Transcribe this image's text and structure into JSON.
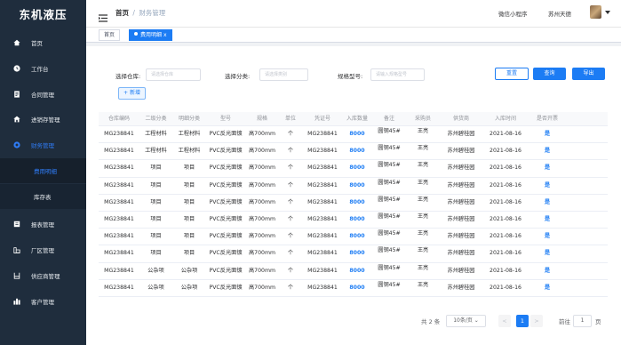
{
  "sidebar": {
    "brand": "东机液压",
    "items": [
      {
        "label": "首页",
        "icon": "home-icon"
      },
      {
        "label": "工作台",
        "icon": "clock-icon"
      },
      {
        "label": "合同管理",
        "icon": "contract-icon"
      },
      {
        "label": "进销存管理",
        "icon": "house-icon"
      },
      {
        "label": "财务管理",
        "icon": "finance-icon"
      },
      {
        "label": "费用明细",
        "icon": ""
      },
      {
        "label": "库存表",
        "icon": ""
      },
      {
        "label": "报表管理",
        "icon": "report-icon"
      },
      {
        "label": "厂区管理",
        "icon": "factory-icon"
      },
      {
        "label": "供应商管理",
        "icon": "supplier-icon"
      },
      {
        "label": "客户管理",
        "icon": "customer-icon"
      }
    ]
  },
  "header": {
    "crumb_home": "首页",
    "crumb_sep": "/",
    "crumb_current": "财务管理",
    "mini_program": "微信小程序",
    "user_name": "苏州天德"
  },
  "tags": {
    "home": "首页",
    "active": "费用明细",
    "close": "x"
  },
  "filters": {
    "warehouse_label": "选择仓库:",
    "warehouse_placeholder": "请选择仓库",
    "category_label": "选择分类:",
    "category_placeholder": "请选择类别",
    "spec_label": "规格型号:",
    "spec_placeholder": "请输入规格型号"
  },
  "buttons": {
    "reset": "重置",
    "query": "查询",
    "export": "导出",
    "add": "+ 新增"
  },
  "table": {
    "columns": [
      "仓库编码",
      "二级分类",
      "明细分类",
      "型号",
      "规格",
      "单位",
      "凭证号",
      "入库数量",
      "备注",
      "采购员",
      "供货商",
      "入库时间",
      "是否开票"
    ],
    "rows": [
      [
        "MG238841",
        "工程材料",
        "工程材料",
        "PVC反光面镀",
        "高700mm",
        "个",
        "MG238841",
        "8000",
        "圆钢45#",
        "王亮",
        "苏州碧桂园",
        "2021-08-16",
        "是"
      ],
      [
        "MG238841",
        "工程材料",
        "工程材料",
        "PVC反光面镀",
        "高700mm",
        "个",
        "MG238841",
        "8000",
        "圆钢45#",
        "王亮",
        "苏州碧桂园",
        "2021-08-16",
        "是"
      ],
      [
        "MG238841",
        "项目",
        "项目",
        "PVC反光面镀",
        "高700mm",
        "个",
        "MG238841",
        "8000",
        "圆钢45#",
        "王亮",
        "苏州碧桂园",
        "2021-08-16",
        "是"
      ],
      [
        "MG238841",
        "项目",
        "项目",
        "PVC反光面镀",
        "高700mm",
        "个",
        "MG238841",
        "8000",
        "圆钢45#",
        "王亮",
        "苏州碧桂园",
        "2021-08-16",
        "是"
      ],
      [
        "MG238841",
        "项目",
        "项目",
        "PVC反光面镀",
        "高700mm",
        "个",
        "MG238841",
        "8000",
        "圆钢45#",
        "王亮",
        "苏州碧桂园",
        "2021-08-16",
        "是"
      ],
      [
        "MG238841",
        "项目",
        "项目",
        "PVC反光面镀",
        "高700mm",
        "个",
        "MG238841",
        "8000",
        "圆钢45#",
        "王亮",
        "苏州碧桂园",
        "2021-08-16",
        "是"
      ],
      [
        "MG238841",
        "项目",
        "项目",
        "PVC反光面镀",
        "高700mm",
        "个",
        "MG238841",
        "8000",
        "圆钢45#",
        "王亮",
        "苏州碧桂园",
        "2021-08-16",
        "是"
      ],
      [
        "MG238841",
        "项目",
        "项目",
        "PVC反光面镀",
        "高700mm",
        "个",
        "MG238841",
        "8000",
        "圆钢45#",
        "王亮",
        "苏州碧桂园",
        "2021-08-16",
        "是"
      ],
      [
        "MG238841",
        "公杂项",
        "公杂项",
        "PVC反光面镀",
        "高700mm",
        "个",
        "MG238841",
        "8000",
        "圆钢45#",
        "王亮",
        "苏州碧桂园",
        "2021-08-16",
        "是"
      ],
      [
        "MG238841",
        "公杂项",
        "公杂项",
        "PVC反光面镀",
        "高700mm",
        "个",
        "MG238841",
        "8000",
        "圆钢45#",
        "王亮",
        "苏州碧桂园",
        "2021-08-16",
        "是"
      ]
    ]
  },
  "pagination": {
    "total": "共 2 条",
    "page_size": "10条/页",
    "prev": "<",
    "current": "1",
    "next": ">",
    "goto_prefix": "前往",
    "goto_value": "1",
    "goto_suffix": "页"
  },
  "colors": {
    "sidebar_bg": "#1f2d3d",
    "accent": "#1c7cf4"
  }
}
